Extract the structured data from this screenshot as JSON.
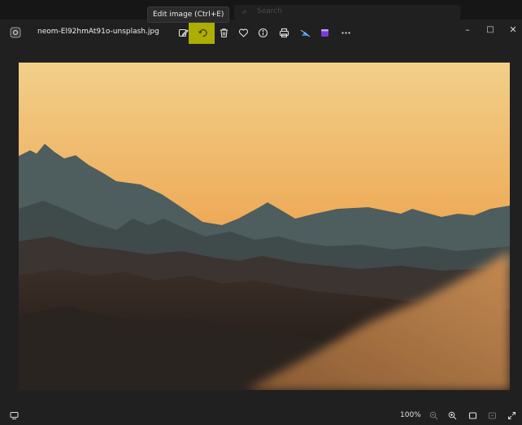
{
  "tooltip": {
    "text": "Edit image (Ctrl+E)"
  },
  "background_search": {
    "placeholder": "Search"
  },
  "window": {
    "filename": "neom-El92hmAt91o-unsplash.jpg"
  },
  "toolbar": {
    "icons": [
      "edit-image-icon",
      "rotate-icon",
      "delete-icon",
      "favorite-icon",
      "info-icon",
      "print-icon",
      "onedrive-icon",
      "clipchamp-icon",
      "more-icon"
    ]
  },
  "window_controls": {
    "minimize": "–",
    "maximize": "□",
    "close": "✕"
  },
  "statusbar": {
    "zoom": "100%"
  },
  "colors": {
    "highlight": "#bcbd00",
    "background": "#202020",
    "sky_top": "#f0c27a",
    "sky_bottom": "#e58a2a"
  }
}
